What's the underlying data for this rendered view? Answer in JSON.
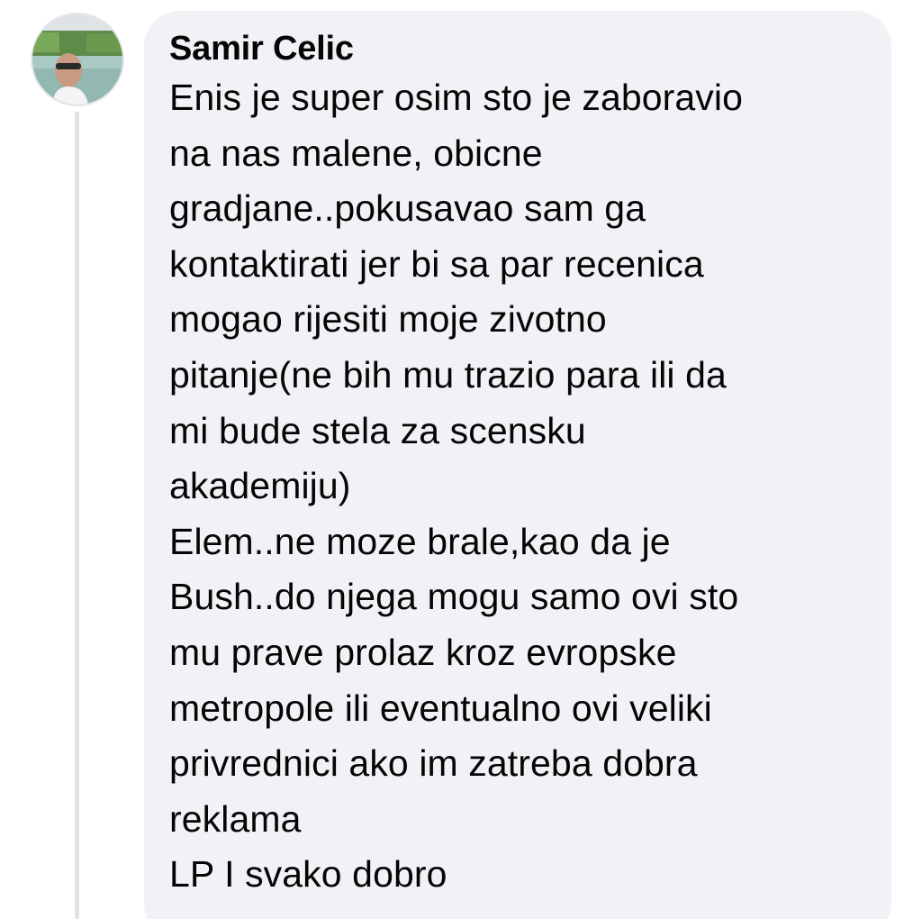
{
  "comment": {
    "author_name": "Samir Celic",
    "avatar_icon": "profile-photo",
    "lines": [
      "Enis je super osim sto je zaboravio",
      "na nas malene, obicne",
      "gradjane..pokusavao sam ga",
      "kontaktirati jer bi sa par recenica",
      "mogao rijesiti moje zivotno",
      "pitanje(ne bih mu trazio para ili da",
      "mi bude stela za scensku",
      "akademiju)",
      "Elem..ne moze brale,kao da je",
      "Bush..do njega mogu samo ovi sto",
      "mu prave prolaz kroz evropske",
      "metropole ili eventualno ovi veliki",
      "privrednici ako im zatreba dobra",
      "reklama",
      "LP I svako dobro"
    ]
  },
  "colors": {
    "bubble_background": "#f0f2f5",
    "text": "#050505",
    "thread_line": "#dfe1e5"
  }
}
